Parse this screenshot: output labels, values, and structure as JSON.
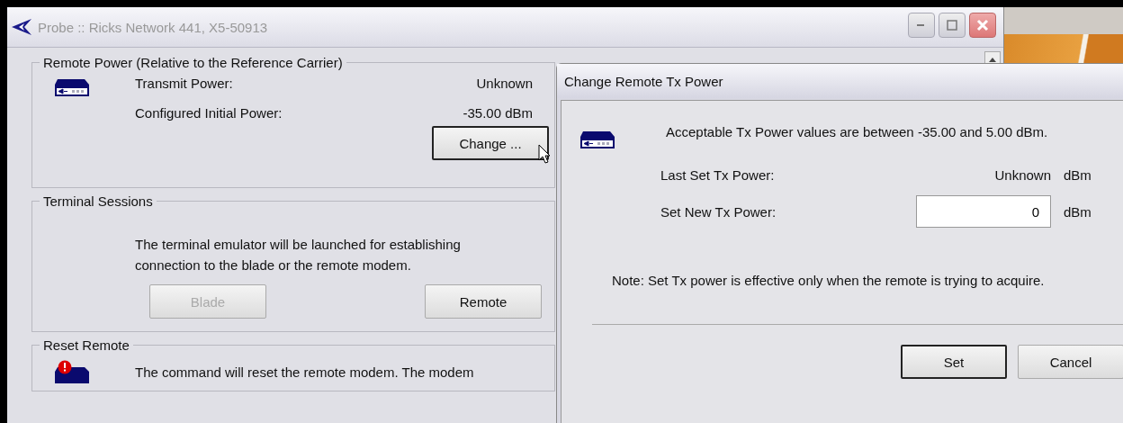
{
  "main_window": {
    "title": "Probe :: Ricks Network 441, X5-50913",
    "remote_power": {
      "legend": "Remote Power (Relative to the Reference Carrier)",
      "rows": [
        {
          "label": "Transmit Power:",
          "value": "Unknown"
        },
        {
          "label": "Configured Initial Power:",
          "value": "-35.00 dBm"
        }
      ],
      "button": {
        "label": "Change ...",
        "default": true
      }
    },
    "terminal_sessions": {
      "legend": "Terminal Sessions",
      "text": "The terminal emulator will be launched for establishing connection to the blade or the remote modem.",
      "buttons": [
        {
          "label": "Blade",
          "disabled": true
        },
        {
          "label": "Remote",
          "disabled": false
        }
      ]
    },
    "reset_remote": {
      "legend": "Reset Remote",
      "text": "The command will reset the remote modem. The modem"
    }
  },
  "dialog": {
    "title": "Change Remote Tx Power",
    "message": "Acceptable Tx Power values are between -35.00 and 5.00 dBm.",
    "last_set": {
      "label": "Last Set Tx Power:",
      "value": "Unknown",
      "unit": "dBm"
    },
    "new_power": {
      "label": "Set New Tx Power:",
      "value": "0",
      "unit": "dBm"
    },
    "note": "Note: Set Tx power is effective only when the remote is trying to acquire.",
    "buttons": [
      {
        "label": "Set",
        "default": true
      },
      {
        "label": "Cancel",
        "default": false
      }
    ]
  }
}
